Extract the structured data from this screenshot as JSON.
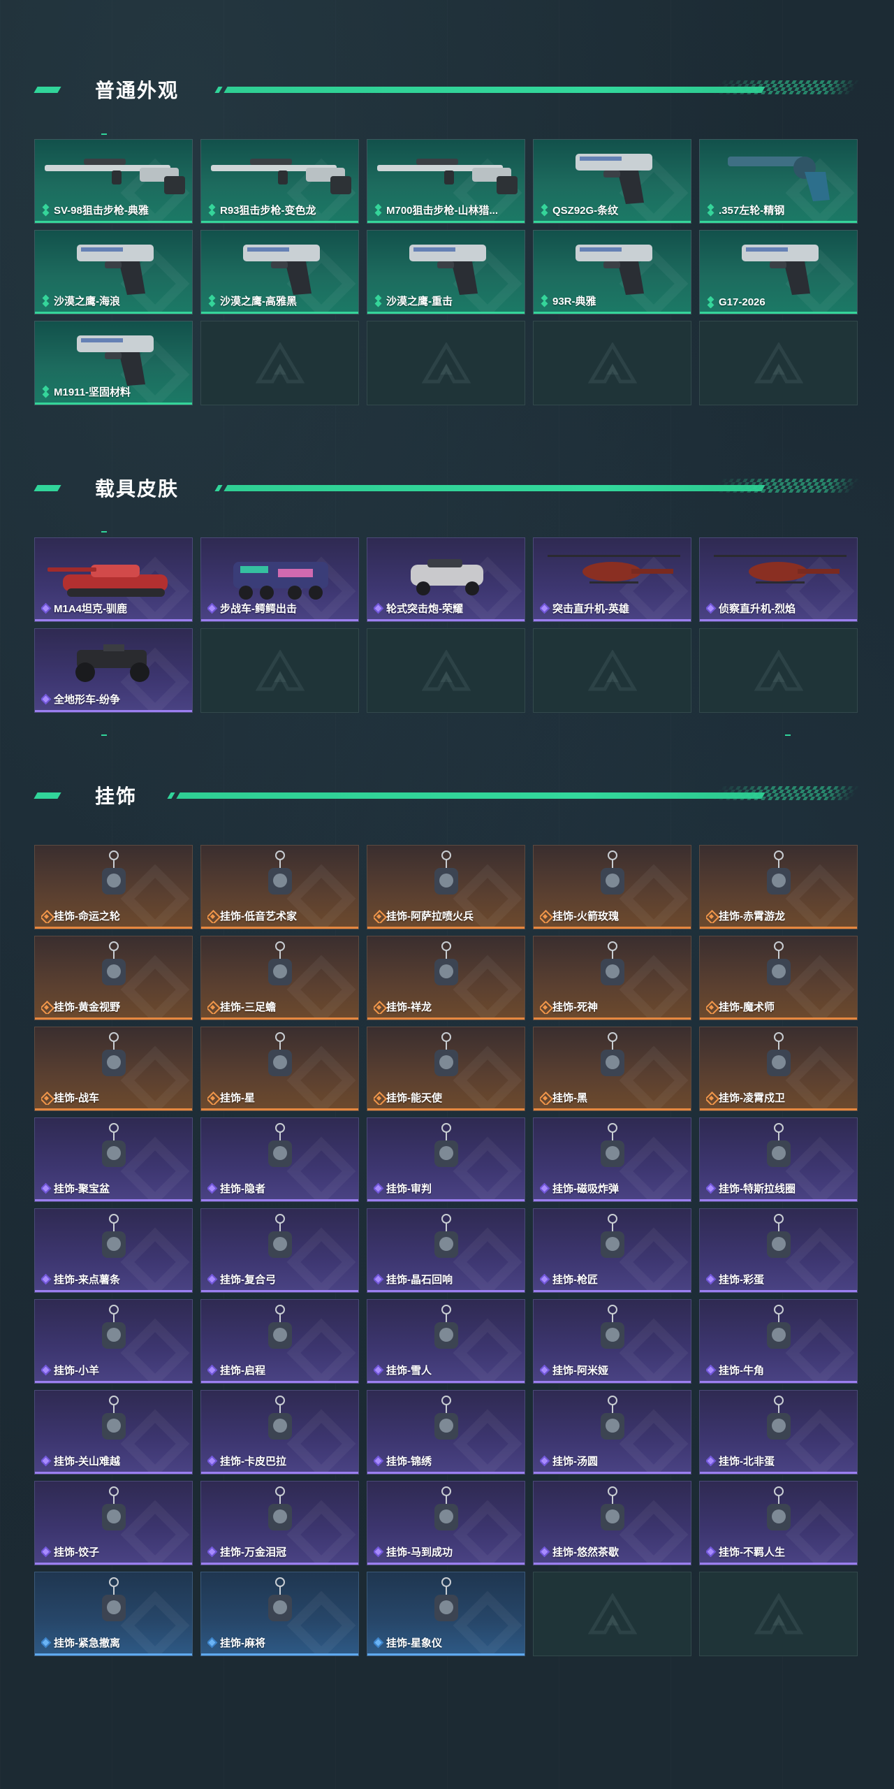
{
  "colors": {
    "accent": "#31d59a",
    "rarity_green": "#35d59a",
    "rarity_purple": "#9b7ff0",
    "rarity_orange": "#e68840",
    "rarity_blue": "#5fa9ef",
    "background": "#1b2a33"
  },
  "sections": [
    {
      "title": "普通外观",
      "items": [
        {
          "label": "SV-98狙击步枪-典雅",
          "rarity": "green",
          "art": "sniper-rifle"
        },
        {
          "label": "R93狙击步枪-变色龙",
          "rarity": "green",
          "art": "sniper-rifle"
        },
        {
          "label": "M700狙击步枪-山林猎...",
          "rarity": "green",
          "art": "sniper-rifle"
        },
        {
          "label": "QSZ92G-条纹",
          "rarity": "green",
          "art": "pistol"
        },
        {
          "label": ".357左轮-精钢",
          "rarity": "green",
          "art": "revolver"
        },
        {
          "label": "沙漠之鹰-海浪",
          "rarity": "green",
          "art": "pistol"
        },
        {
          "label": "沙漠之鹰-高雅黑",
          "rarity": "green",
          "art": "pistol"
        },
        {
          "label": "沙漠之鹰-重击",
          "rarity": "green",
          "art": "pistol"
        },
        {
          "label": "93R-典雅",
          "rarity": "green",
          "art": "pistol"
        },
        {
          "label": "G17-2026",
          "rarity": "green",
          "art": "pistol"
        },
        {
          "label": "M1911-坚固材料",
          "rarity": "green",
          "art": "pistol"
        },
        {
          "label": "",
          "rarity": "empty"
        },
        {
          "label": "",
          "rarity": "empty"
        },
        {
          "label": "",
          "rarity": "empty"
        },
        {
          "label": "",
          "rarity": "empty"
        }
      ]
    },
    {
      "title": "载具皮肤",
      "items": [
        {
          "label": "M1A4坦克-驯鹿",
          "rarity": "purple",
          "art": "tank"
        },
        {
          "label": "步战车-鳄鳄出击",
          "rarity": "purple",
          "art": "apc"
        },
        {
          "label": "轮式突击炮-荣耀",
          "rarity": "purple",
          "art": "car"
        },
        {
          "label": "突击直升机-英雄",
          "rarity": "purple",
          "art": "helicopter"
        },
        {
          "label": "侦察直升机-烈焰",
          "rarity": "purple",
          "art": "helicopter"
        },
        {
          "label": "全地形车-纷争",
          "rarity": "purple",
          "art": "atv"
        },
        {
          "label": "",
          "rarity": "empty"
        },
        {
          "label": "",
          "rarity": "empty"
        },
        {
          "label": "",
          "rarity": "empty"
        },
        {
          "label": "",
          "rarity": "empty"
        }
      ]
    },
    {
      "title": "挂饰",
      "items": [
        {
          "label": "挂饰-命运之轮",
          "rarity": "orange",
          "art": "charm"
        },
        {
          "label": "挂饰-低音艺术家",
          "rarity": "orange",
          "art": "charm"
        },
        {
          "label": "挂饰-阿萨拉喷火兵",
          "rarity": "orange",
          "art": "charm"
        },
        {
          "label": "挂饰-火箭玫瑰",
          "rarity": "orange",
          "art": "charm"
        },
        {
          "label": "挂饰-赤霄游龙",
          "rarity": "orange",
          "art": "charm"
        },
        {
          "label": "挂饰-黄金视野",
          "rarity": "orange",
          "art": "charm"
        },
        {
          "label": "挂饰-三足蟾",
          "rarity": "orange",
          "art": "charm"
        },
        {
          "label": "挂饰-祥龙",
          "rarity": "orange",
          "art": "charm"
        },
        {
          "label": "挂饰-死神",
          "rarity": "orange",
          "art": "charm"
        },
        {
          "label": "挂饰-魔术师",
          "rarity": "orange",
          "art": "charm"
        },
        {
          "label": "挂饰-战车",
          "rarity": "orange",
          "art": "charm"
        },
        {
          "label": "挂饰-星",
          "rarity": "orange",
          "art": "charm"
        },
        {
          "label": "挂饰-能天使",
          "rarity": "orange",
          "art": "charm"
        },
        {
          "label": "挂饰-黑",
          "rarity": "orange",
          "art": "charm"
        },
        {
          "label": "挂饰-凌霄戍卫",
          "rarity": "orange",
          "art": "charm"
        },
        {
          "label": "挂饰-聚宝盆",
          "rarity": "purple",
          "art": "charm"
        },
        {
          "label": "挂饰-隐者",
          "rarity": "purple",
          "art": "charm"
        },
        {
          "label": "挂饰-审判",
          "rarity": "purple",
          "art": "charm"
        },
        {
          "label": "挂饰-磁吸炸弹",
          "rarity": "purple",
          "art": "charm"
        },
        {
          "label": "挂饰-特斯拉线圈",
          "rarity": "purple",
          "art": "charm"
        },
        {
          "label": "挂饰-来点薯条",
          "rarity": "purple",
          "art": "charm"
        },
        {
          "label": "挂饰-复合弓",
          "rarity": "purple",
          "art": "charm"
        },
        {
          "label": "挂饰-晶石回响",
          "rarity": "purple",
          "art": "charm"
        },
        {
          "label": "挂饰-枪匠",
          "rarity": "purple",
          "art": "charm"
        },
        {
          "label": "挂饰-彩蛋",
          "rarity": "purple",
          "art": "charm"
        },
        {
          "label": "挂饰-小羊",
          "rarity": "purple",
          "art": "charm"
        },
        {
          "label": "挂饰-启程",
          "rarity": "purple",
          "art": "charm"
        },
        {
          "label": "挂饰-雪人",
          "rarity": "purple",
          "art": "charm"
        },
        {
          "label": "挂饰-阿米娅",
          "rarity": "purple",
          "art": "charm"
        },
        {
          "label": "挂饰-牛角",
          "rarity": "purple",
          "art": "charm"
        },
        {
          "label": "挂饰-关山难越",
          "rarity": "purple",
          "art": "charm"
        },
        {
          "label": "挂饰-卡皮巴拉",
          "rarity": "purple",
          "art": "charm"
        },
        {
          "label": "挂饰-锦绣",
          "rarity": "purple",
          "art": "charm"
        },
        {
          "label": "挂饰-汤圆",
          "rarity": "purple",
          "art": "charm"
        },
        {
          "label": "挂饰-北非蛋",
          "rarity": "purple",
          "art": "charm"
        },
        {
          "label": "挂饰-饺子",
          "rarity": "purple",
          "art": "charm"
        },
        {
          "label": "挂饰-万金泪冠",
          "rarity": "purple",
          "art": "charm"
        },
        {
          "label": "挂饰-马到成功",
          "rarity": "purple",
          "art": "charm"
        },
        {
          "label": "挂饰-悠然茶歇",
          "rarity": "purple",
          "art": "charm"
        },
        {
          "label": "挂饰-不羁人生",
          "rarity": "purple",
          "art": "charm"
        },
        {
          "label": "挂饰-紧急撤离",
          "rarity": "blue",
          "art": "charm"
        },
        {
          "label": "挂饰-麻将",
          "rarity": "blue",
          "art": "charm"
        },
        {
          "label": "挂饰-星象仪",
          "rarity": "blue",
          "art": "charm"
        },
        {
          "label": "",
          "rarity": "empty"
        },
        {
          "label": "",
          "rarity": "empty"
        }
      ]
    }
  ]
}
